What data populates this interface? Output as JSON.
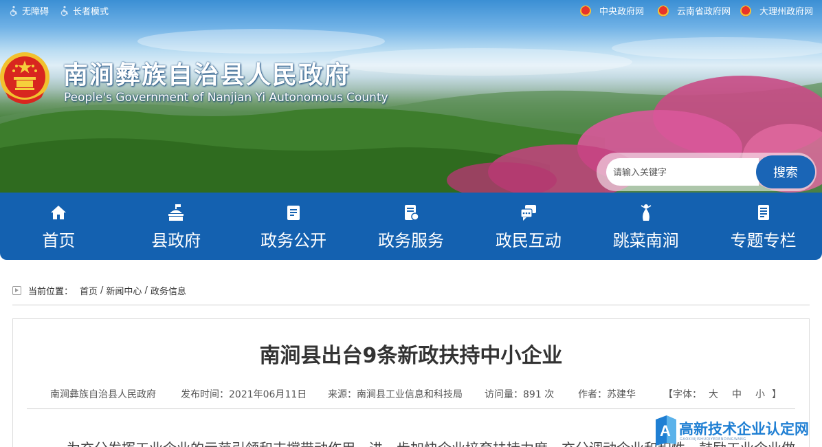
{
  "topbar": {
    "accessibility": "无障碍",
    "elder_mode": "长者模式",
    "links": [
      "中央政府网",
      "云南省政府网",
      "大理州政府网"
    ]
  },
  "header": {
    "title": "南涧彝族自治县人民政府",
    "subtitle": "People's Government of Nanjian Yi Autonomous County"
  },
  "search": {
    "placeholder": "请输入关键字",
    "button": "搜索"
  },
  "nav": {
    "items": [
      {
        "label": "首页",
        "icon": "home-icon"
      },
      {
        "label": "县政府",
        "icon": "government-building-icon"
      },
      {
        "label": "政务公开",
        "icon": "document-icon"
      },
      {
        "label": "政务服务",
        "icon": "service-icon"
      },
      {
        "label": "政民互动",
        "icon": "chat-icon"
      },
      {
        "label": "跳菜南涧",
        "icon": "dancer-icon"
      },
      {
        "label": "专题专栏",
        "icon": "column-icon"
      }
    ]
  },
  "breadcrumb": {
    "prefix": "当前位置：",
    "items": [
      "首页",
      "新闻中心",
      "政务信息"
    ]
  },
  "article": {
    "title": "南涧县出台9条新政扶持中小企业",
    "meta": {
      "publisher": "南涧彝族自治县人民政府",
      "date_label": "发布时间：",
      "date": "2021年06月11日",
      "source_label": "来源：",
      "source": "南涧县工业信息和科技局",
      "views_label": "访问量：",
      "views": "891",
      "views_unit": "次",
      "author_label": "作者：",
      "author": "苏建华",
      "font_label": "【字体：",
      "font_large": "大",
      "font_medium": "中",
      "font_small": "小",
      "font_close": "】"
    },
    "body_first_line": "为充分发挥工业企业的示范引领和支撑带动作用，进一步加快企业培育扶持力度，充分调动企业和积性，鼓励工业企业做强做"
  },
  "watermark": {
    "text": "高新技术企业认定网",
    "sub": "GAOXINJISHUQIYERENDINGWANG"
  },
  "colors": {
    "nav_blue": "#1461b0",
    "search_blue": "#1a65b6",
    "watermark_blue": "#1f7fd3"
  }
}
